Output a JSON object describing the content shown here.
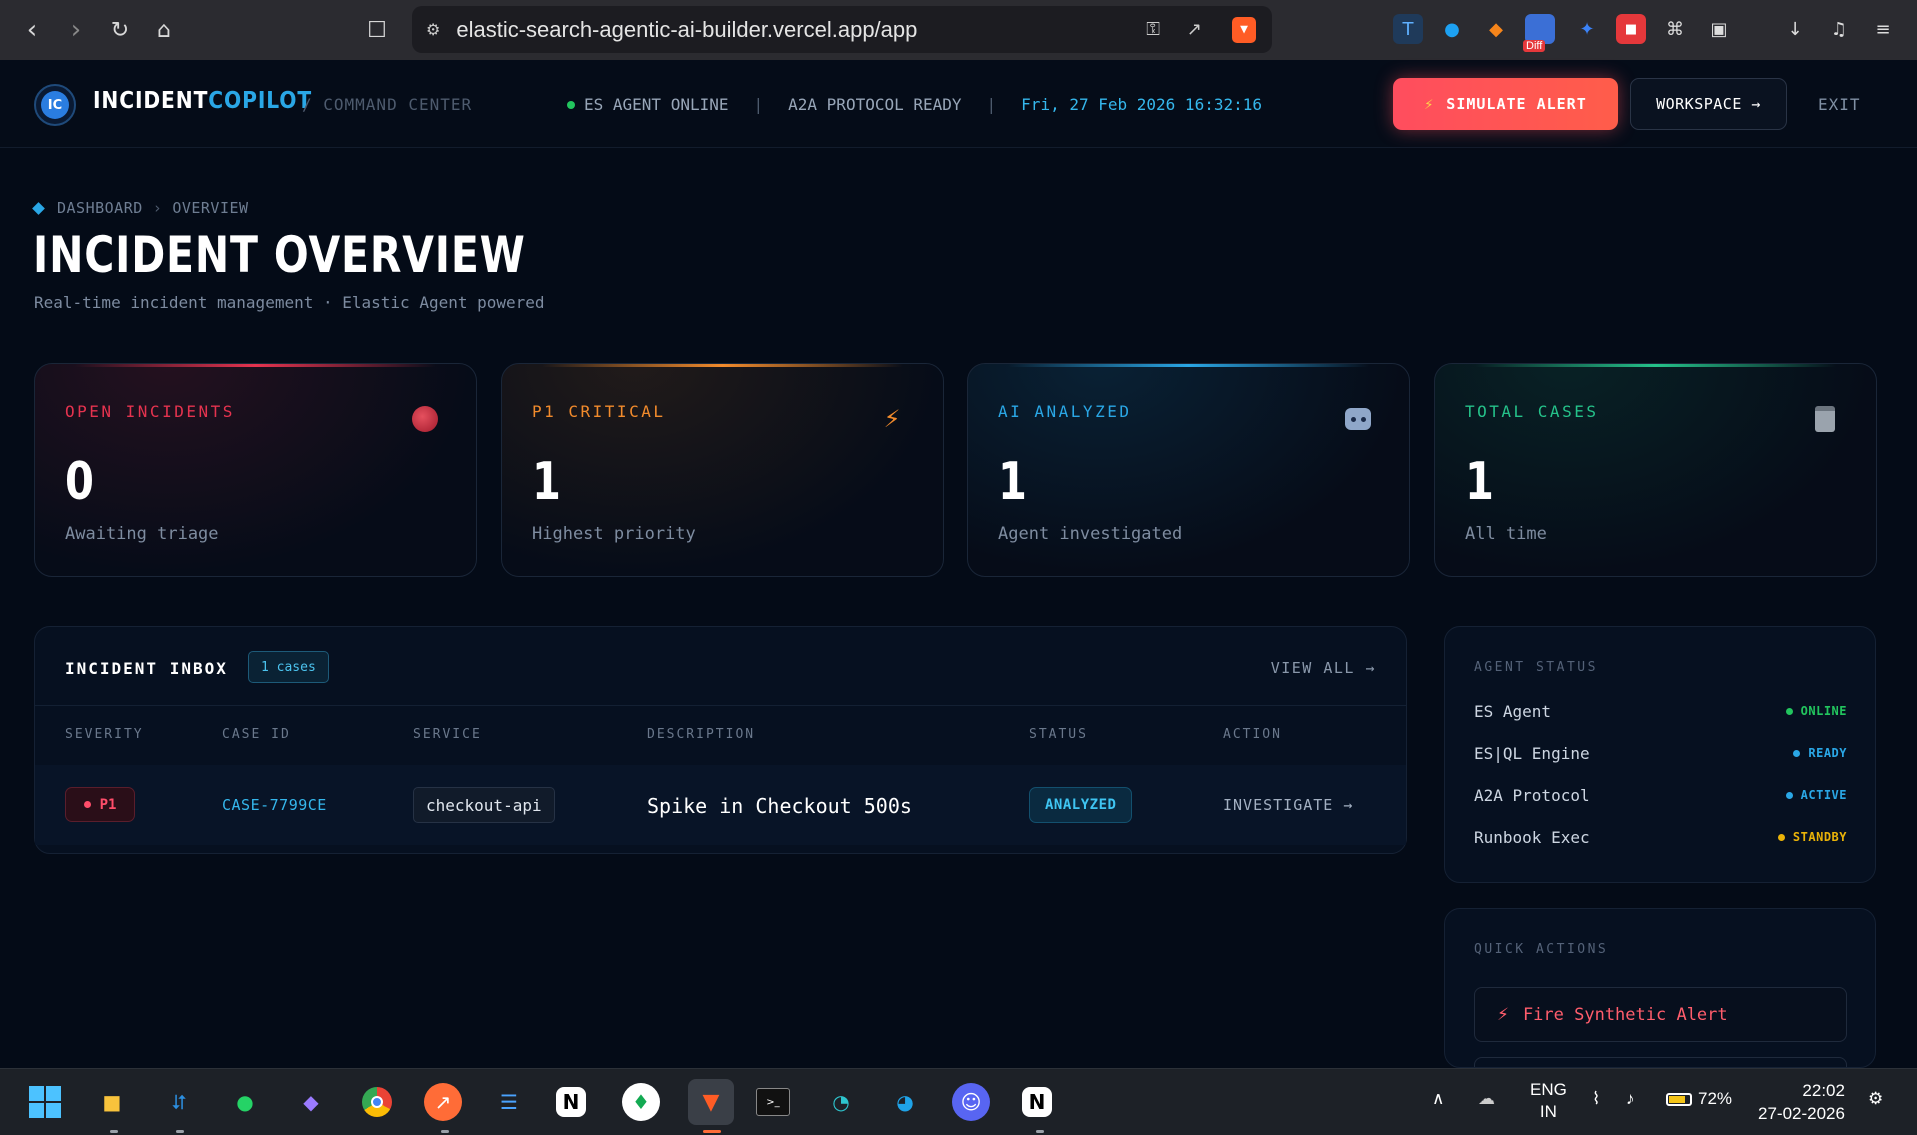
{
  "browser": {
    "url": "elastic-search-agentic-ai-builder.vercel.app/app",
    "ext_badge": "Diff"
  },
  "header": {
    "brand_part1": "INCIDENT",
    "brand_part2": "COPILOT",
    "logo_initials": "IC",
    "section": "/ COMMAND CENTER",
    "agent_status": "ES AGENT ONLINE",
    "protocol_status": "A2A PROTOCOL READY",
    "datetime": "Fri, 27 Feb 2026 16:32:16",
    "simulate_label": "SIMULATE ALERT",
    "workspace_label": "WORKSPACE →",
    "exit_label": "EXIT",
    "colors": {
      "accent": "#2aa7e6",
      "alert": "#ff4d5e",
      "online": "#22c55e"
    }
  },
  "breadcrumb": {
    "root": "DASHBOARD",
    "current": "OVERVIEW"
  },
  "page": {
    "title": "INCIDENT OVERVIEW",
    "subtitle": "Real-time incident management · Elastic Agent powered"
  },
  "stats": [
    {
      "label": "OPEN INCIDENTS",
      "value": "0",
      "sub": "Awaiting triage",
      "icon": "red-circle-icon",
      "color": "#e5334f"
    },
    {
      "label": "P1 CRITICAL",
      "value": "1",
      "sub": "Highest priority",
      "icon": "lightning-icon",
      "color": "#f28b2c"
    },
    {
      "label": "AI ANALYZED",
      "value": "1",
      "sub": "Agent investigated",
      "icon": "robot-icon",
      "color": "#2aa7e6"
    },
    {
      "label": "TOTAL CASES",
      "value": "1",
      "sub": "All time",
      "icon": "clipboard-icon",
      "color": "#25c28a"
    }
  ],
  "inbox": {
    "title": "INCIDENT INBOX",
    "badge": "1 cases",
    "view_all": "VIEW ALL →",
    "columns": [
      "SEVERITY",
      "CASE ID",
      "SERVICE",
      "DESCRIPTION",
      "STATUS",
      "ACTION"
    ],
    "rows": [
      {
        "severity": "P1",
        "case_id": "CASE-7799CE",
        "service": "checkout-api",
        "description": "Spike in Checkout 500s",
        "status": "ANALYZED",
        "action": "INVESTIGATE →"
      }
    ]
  },
  "agent_status": {
    "title": "AGENT STATUS",
    "items": [
      {
        "name": "ES Agent",
        "status": "ONLINE",
        "color": "#22c55e"
      },
      {
        "name": "ES|QL Engine",
        "status": "READY",
        "color": "#2aa7e6"
      },
      {
        "name": "A2A Protocol",
        "status": "ACTIVE",
        "color": "#2aa7e6"
      },
      {
        "name": "Runbook Exec",
        "status": "STANDBY",
        "color": "#eab308"
      }
    ]
  },
  "quick_actions": {
    "title": "QUICK ACTIONS",
    "fire_label": "Fire Synthetic Alert"
  },
  "taskbar": {
    "lang": "ENG",
    "region": "IN",
    "battery": "72%",
    "time": "22:02",
    "date": "27-02-2026"
  }
}
